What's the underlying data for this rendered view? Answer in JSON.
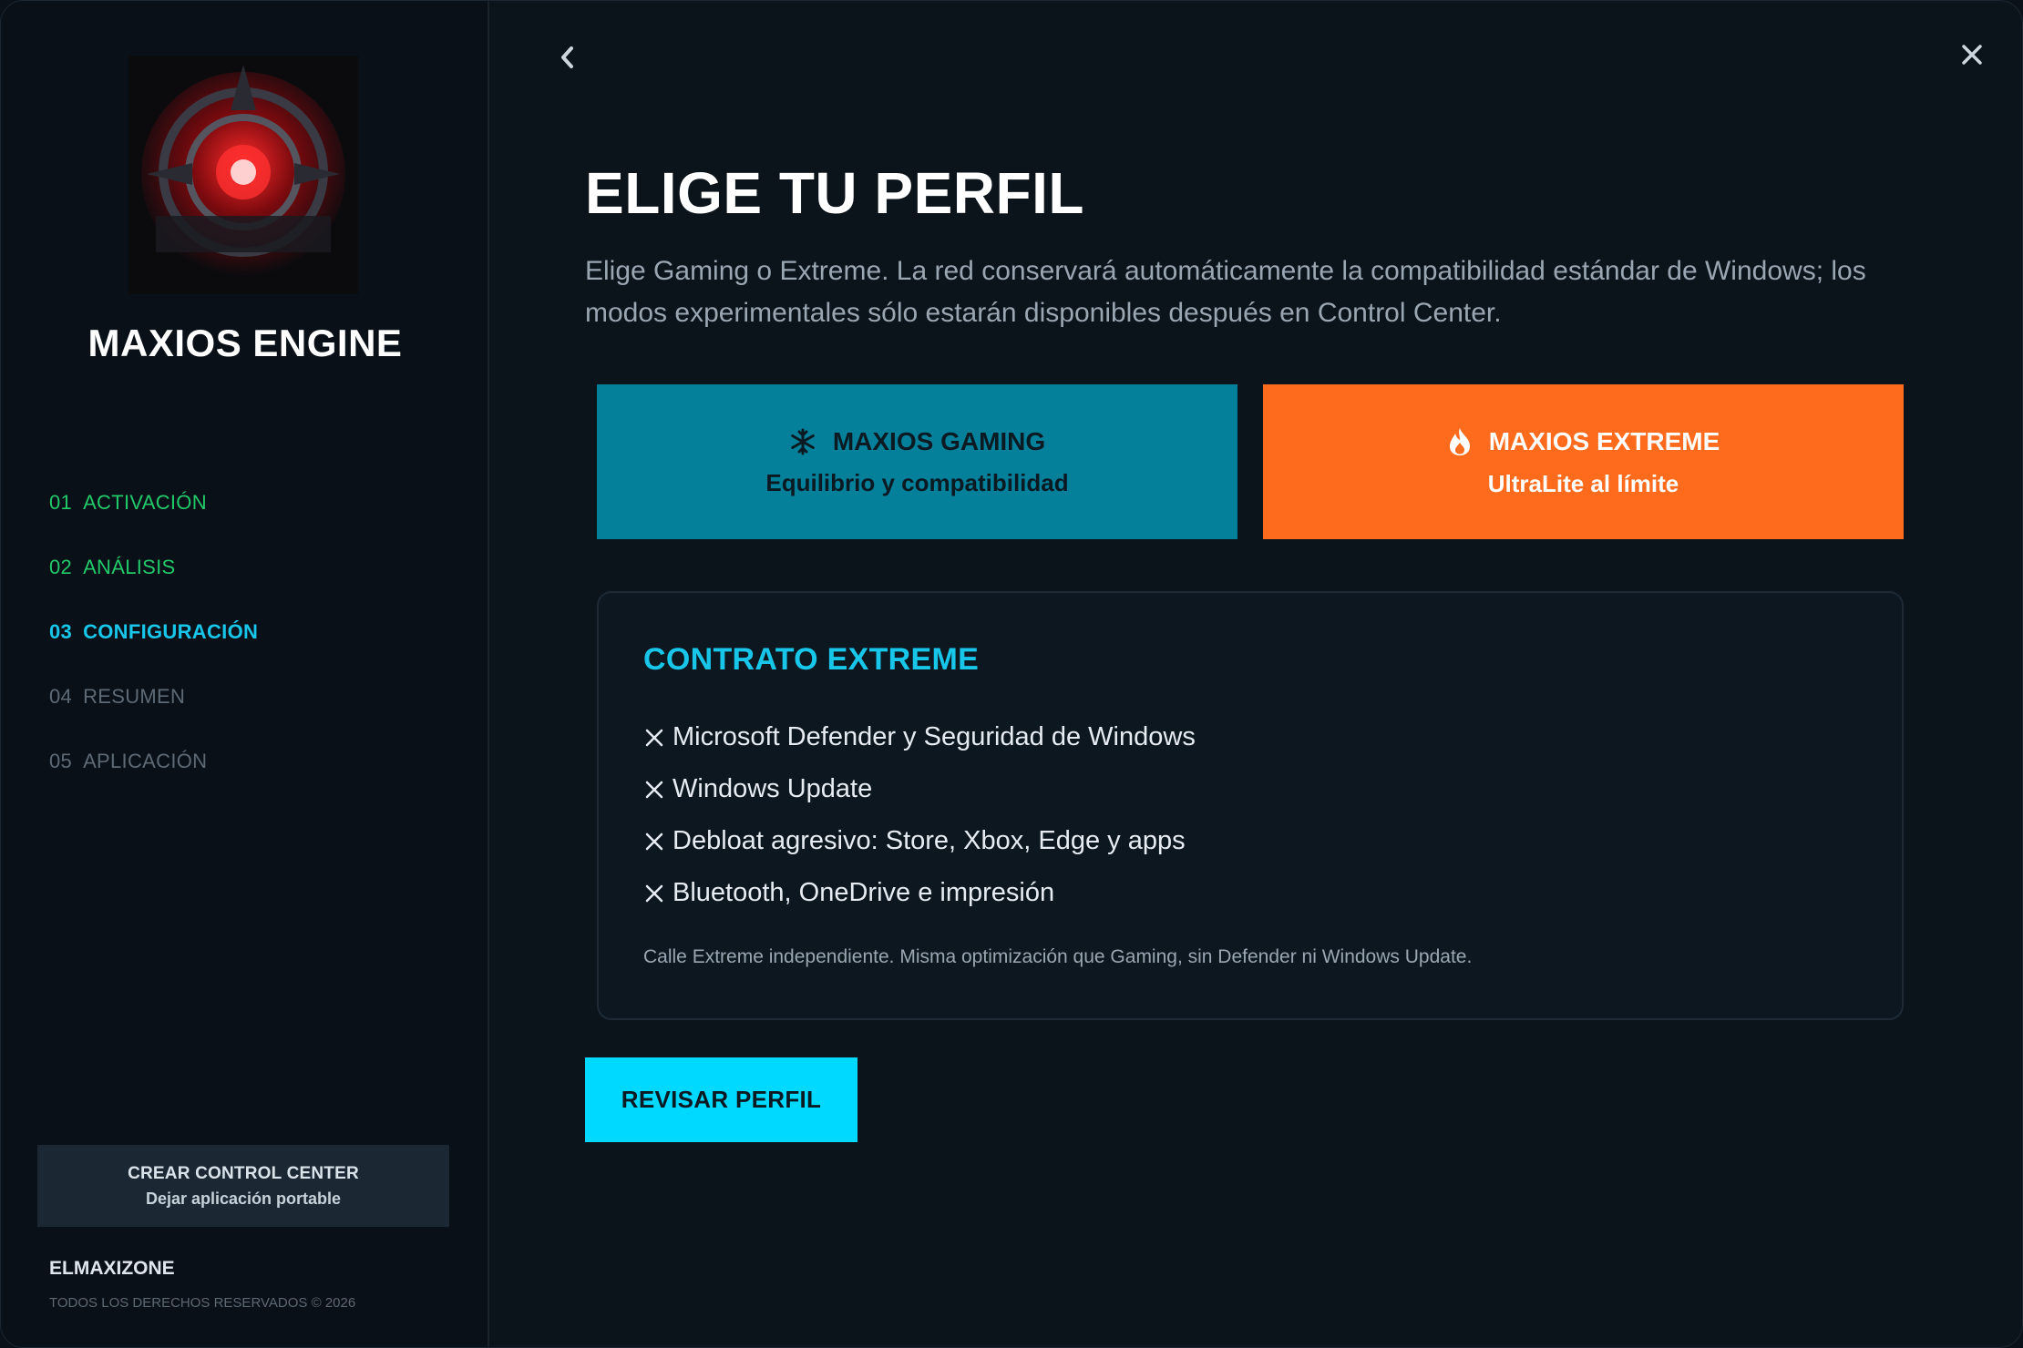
{
  "sidebar": {
    "logo_text": "MAXIOS ENGINE",
    "app_name": "MAXIOS ENGINE",
    "steps": [
      {
        "num": "01",
        "label": "ACTIVACIÓN",
        "state": "done"
      },
      {
        "num": "02",
        "label": "ANÁLISIS",
        "state": "done"
      },
      {
        "num": "03",
        "label": "CONFIGURACIÓN",
        "state": "active"
      },
      {
        "num": "04",
        "label": "RESUMEN",
        "state": "pending"
      },
      {
        "num": "05",
        "label": "APLICACIÓN",
        "state": "pending"
      }
    ],
    "control_center_button": {
      "line1": "CREAR CONTROL CENTER",
      "line2": "Dejar aplicación portable"
    },
    "brand": "ELMAXIZONE",
    "copyright": "TODOS LOS DERECHOS RESERVADOS © 2026"
  },
  "header": {
    "back_icon": "chevron-left-icon",
    "close_icon": "close-icon"
  },
  "main": {
    "title": "ELIGE TU PERFIL",
    "subtitle": "Elige Gaming o Extreme. La red conservará automáticamente la compatibilidad estándar de Windows; los modos experimentales sólo estarán disponibles después en Control Center.",
    "profiles": {
      "gaming": {
        "name": "MAXIOS GAMING",
        "description": "Equilibrio y compatibilidad",
        "icon": "snowflake-icon",
        "color": "#04809a"
      },
      "extreme": {
        "name": "MAXIOS EXTREME",
        "description": "UltraLite al límite",
        "icon": "flame-icon",
        "color": "#ff6b1c",
        "selected": true
      }
    },
    "contract": {
      "title": "CONTRATO EXTREME",
      "items": [
        "Microsoft Defender y Seguridad de Windows",
        "Windows Update",
        "Debloat agresivo: Store, Xbox, Edge y apps",
        "Bluetooth, OneDrive e impresión"
      ],
      "note": "Calle Extreme independiente. Misma optimización que Gaming, sin Defender ni Windows Update."
    },
    "review_button": "REVISAR PERFIL"
  },
  "colors": {
    "accent": "#18c6ea",
    "done": "#22c96a",
    "pending": "#5d6a76",
    "button": "#00d9ff"
  }
}
